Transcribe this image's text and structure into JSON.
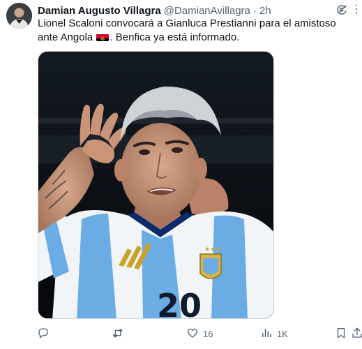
{
  "tweet": {
    "author": {
      "display_name": "Damian Augusto Villagra",
      "handle": "@DamianAvillagra",
      "separator": "·",
      "time": "2h"
    },
    "text_before_flag": "Lionel Scaloni convocará a Gianluca Prestianni para el amistoso ante Angola",
    "text_after_flag": ". Benfica ya está informado.",
    "flag_icon": "angola-flag-icon",
    "media": {
      "jersey_number": "20"
    },
    "actions": {
      "reply": {
        "icon": "reply-icon",
        "count": ""
      },
      "retweet": {
        "icon": "retweet-icon",
        "count": ""
      },
      "like": {
        "icon": "heart-icon",
        "count": "16"
      },
      "views": {
        "icon": "views-icon",
        "count": "1K"
      },
      "bookmark": {
        "icon": "bookmark-icon",
        "count": ""
      },
      "share": {
        "icon": "share-icon",
        "count": ""
      }
    }
  },
  "colors": {
    "text_primary": "#0f1419",
    "text_secondary": "#536471",
    "border": "#cfd9de",
    "argentina_sky_blue": "#6cace4",
    "angola_red": "#cc092f",
    "angola_yellow": "#ffcb00"
  }
}
